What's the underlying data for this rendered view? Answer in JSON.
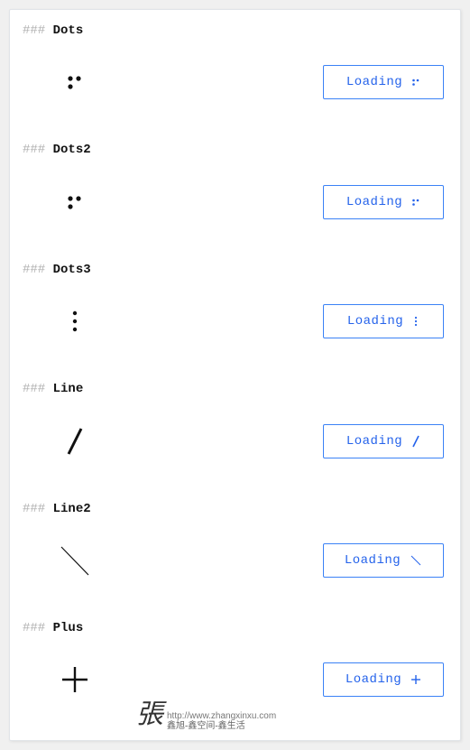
{
  "sections": [
    {
      "id": "dots",
      "heading": "Dots",
      "button": "Loading",
      "icon": "dots"
    },
    {
      "id": "dots2",
      "heading": "Dots2",
      "button": "Loading",
      "icon": "dots"
    },
    {
      "id": "dots3",
      "heading": "Dots3",
      "button": "Loading",
      "icon": "dots-v"
    },
    {
      "id": "line",
      "heading": "Line",
      "button": "Loading",
      "icon": "slash"
    },
    {
      "id": "line2",
      "heading": "Line2",
      "button": "Loading",
      "icon": "backslash"
    },
    {
      "id": "plus",
      "heading": "Plus",
      "button": "Loading",
      "icon": "plus"
    }
  ],
  "pound": "###",
  "watermark": {
    "big": "張",
    "url": "http://www.zhangxinxu.com",
    "sub": "鑫旭-鑫空间-鑫生活"
  }
}
